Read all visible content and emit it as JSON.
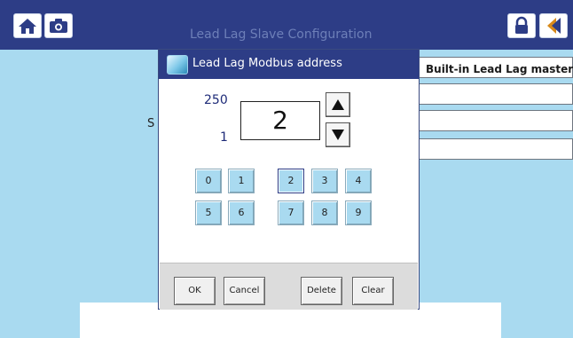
{
  "header": {
    "title": "Lead Lag Slave Configuration",
    "icons": {
      "home": "home-icon",
      "camera": "camera-icon",
      "lock": "lock-icon",
      "back": "back-arrow-icon"
    }
  },
  "background": {
    "field_text": "Built-in Lead Lag master",
    "label_fragment": "S"
  },
  "dialog": {
    "title": "Lead Lag Modbus address",
    "icon": "keypad-app-icon",
    "max_value": "250",
    "min_value": "1",
    "current_value": "2",
    "up_icon": "arrow-up-icon",
    "down_icon": "arrow-down-icon",
    "keys": [
      "0",
      "1",
      "2",
      "3",
      "4",
      "5",
      "6",
      "7",
      "8",
      "9"
    ],
    "buttons": {
      "ok": "OK",
      "cancel": "Cancel",
      "delete": "Delete",
      "clear": "Clear"
    }
  },
  "colors": {
    "header": "#2d3d86",
    "background": "#a9daf0",
    "key": "#a9daf0"
  }
}
